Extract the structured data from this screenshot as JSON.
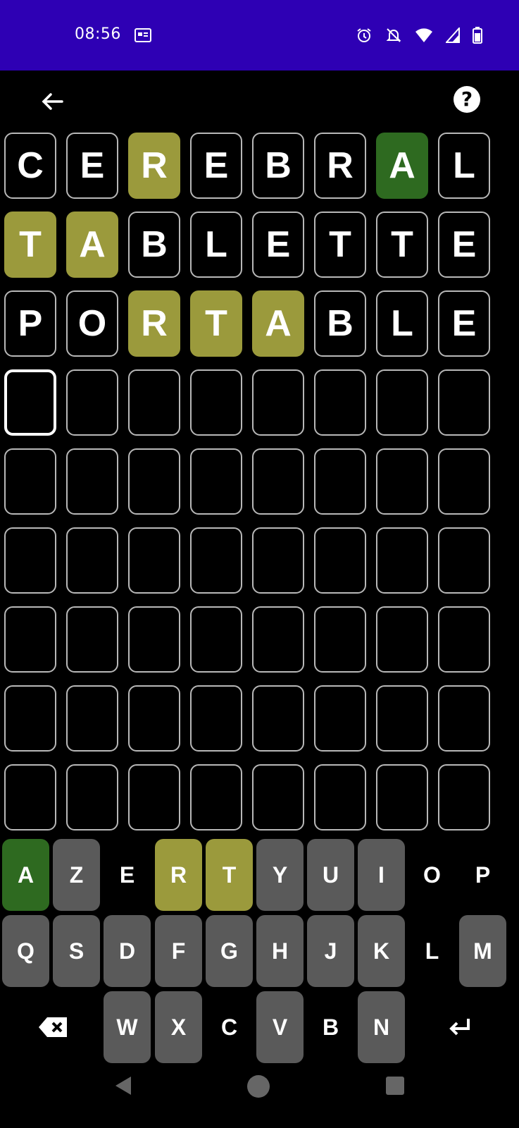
{
  "status_bar": {
    "time": "08:56"
  },
  "header": {
    "back_icon": "arrow-left-icon",
    "help_label": "?"
  },
  "board": {
    "rows": [
      [
        {
          "l": "C",
          "s": "empty"
        },
        {
          "l": "E",
          "s": "empty"
        },
        {
          "l": "R",
          "s": "present"
        },
        {
          "l": "E",
          "s": "empty"
        },
        {
          "l": "B",
          "s": "empty"
        },
        {
          "l": "R",
          "s": "empty"
        },
        {
          "l": "A",
          "s": "correct"
        },
        {
          "l": "L",
          "s": "empty"
        }
      ],
      [
        {
          "l": "T",
          "s": "present"
        },
        {
          "l": "A",
          "s": "present"
        },
        {
          "l": "B",
          "s": "empty"
        },
        {
          "l": "L",
          "s": "empty"
        },
        {
          "l": "E",
          "s": "empty"
        },
        {
          "l": "T",
          "s": "empty"
        },
        {
          "l": "T",
          "s": "empty"
        },
        {
          "l": "E",
          "s": "empty"
        }
      ],
      [
        {
          "l": "P",
          "s": "empty"
        },
        {
          "l": "O",
          "s": "empty"
        },
        {
          "l": "R",
          "s": "present"
        },
        {
          "l": "T",
          "s": "present"
        },
        {
          "l": "A",
          "s": "present"
        },
        {
          "l": "B",
          "s": "empty"
        },
        {
          "l": "L",
          "s": "empty"
        },
        {
          "l": "E",
          "s": "empty"
        }
      ],
      [
        {
          "l": "",
          "s": "active"
        },
        {
          "l": "",
          "s": "empty"
        },
        {
          "l": "",
          "s": "empty"
        },
        {
          "l": "",
          "s": "empty"
        },
        {
          "l": "",
          "s": "empty"
        },
        {
          "l": "",
          "s": "empty"
        },
        {
          "l": "",
          "s": "empty"
        },
        {
          "l": "",
          "s": "empty"
        }
      ],
      [
        {
          "l": "",
          "s": "empty"
        },
        {
          "l": "",
          "s": "empty"
        },
        {
          "l": "",
          "s": "empty"
        },
        {
          "l": "",
          "s": "empty"
        },
        {
          "l": "",
          "s": "empty"
        },
        {
          "l": "",
          "s": "empty"
        },
        {
          "l": "",
          "s": "empty"
        },
        {
          "l": "",
          "s": "empty"
        }
      ],
      [
        {
          "l": "",
          "s": "empty"
        },
        {
          "l": "",
          "s": "empty"
        },
        {
          "l": "",
          "s": "empty"
        },
        {
          "l": "",
          "s": "empty"
        },
        {
          "l": "",
          "s": "empty"
        },
        {
          "l": "",
          "s": "empty"
        },
        {
          "l": "",
          "s": "empty"
        },
        {
          "l": "",
          "s": "empty"
        }
      ],
      [
        {
          "l": "",
          "s": "empty"
        },
        {
          "l": "",
          "s": "empty"
        },
        {
          "l": "",
          "s": "empty"
        },
        {
          "l": "",
          "s": "empty"
        },
        {
          "l": "",
          "s": "empty"
        },
        {
          "l": "",
          "s": "empty"
        },
        {
          "l": "",
          "s": "empty"
        },
        {
          "l": "",
          "s": "empty"
        }
      ],
      [
        {
          "l": "",
          "s": "empty"
        },
        {
          "l": "",
          "s": "empty"
        },
        {
          "l": "",
          "s": "empty"
        },
        {
          "l": "",
          "s": "empty"
        },
        {
          "l": "",
          "s": "empty"
        },
        {
          "l": "",
          "s": "empty"
        },
        {
          "l": "",
          "s": "empty"
        },
        {
          "l": "",
          "s": "empty"
        }
      ],
      [
        {
          "l": "",
          "s": "empty"
        },
        {
          "l": "",
          "s": "empty"
        },
        {
          "l": "",
          "s": "empty"
        },
        {
          "l": "",
          "s": "empty"
        },
        {
          "l": "",
          "s": "empty"
        },
        {
          "l": "",
          "s": "empty"
        },
        {
          "l": "",
          "s": "empty"
        },
        {
          "l": "",
          "s": "empty"
        }
      ]
    ]
  },
  "keyboard": {
    "rows": [
      [
        {
          "k": "A",
          "s": "correct"
        },
        {
          "k": "Z",
          "s": "unused"
        },
        {
          "k": "E",
          "s": "absent"
        },
        {
          "k": "R",
          "s": "present"
        },
        {
          "k": "T",
          "s": "present"
        },
        {
          "k": "Y",
          "s": "unused"
        },
        {
          "k": "U",
          "s": "unused"
        },
        {
          "k": "I",
          "s": "unused"
        },
        {
          "k": "O",
          "s": "absent"
        },
        {
          "k": "P",
          "s": "absent"
        }
      ],
      [
        {
          "k": "Q",
          "s": "unused"
        },
        {
          "k": "S",
          "s": "unused"
        },
        {
          "k": "D",
          "s": "unused"
        },
        {
          "k": "F",
          "s": "unused"
        },
        {
          "k": "G",
          "s": "unused"
        },
        {
          "k": "H",
          "s": "unused"
        },
        {
          "k": "J",
          "s": "unused"
        },
        {
          "k": "K",
          "s": "unused"
        },
        {
          "k": "L",
          "s": "absent"
        },
        {
          "k": "M",
          "s": "unused"
        }
      ],
      [
        {
          "k": "backspace-icon",
          "s": "absent"
        },
        {
          "k": "W",
          "s": "unused"
        },
        {
          "k": "X",
          "s": "unused"
        },
        {
          "k": "C",
          "s": "absent"
        },
        {
          "k": "V",
          "s": "unused"
        },
        {
          "k": "B",
          "s": "absent"
        },
        {
          "k": "N",
          "s": "unused"
        },
        {
          "k": "enter-icon",
          "s": "absent"
        }
      ]
    ]
  },
  "colors": {
    "status_bar": "#2e00b4",
    "present": "#9b9a3c",
    "correct": "#2e6a20",
    "unused_key": "#5a5a5a"
  }
}
